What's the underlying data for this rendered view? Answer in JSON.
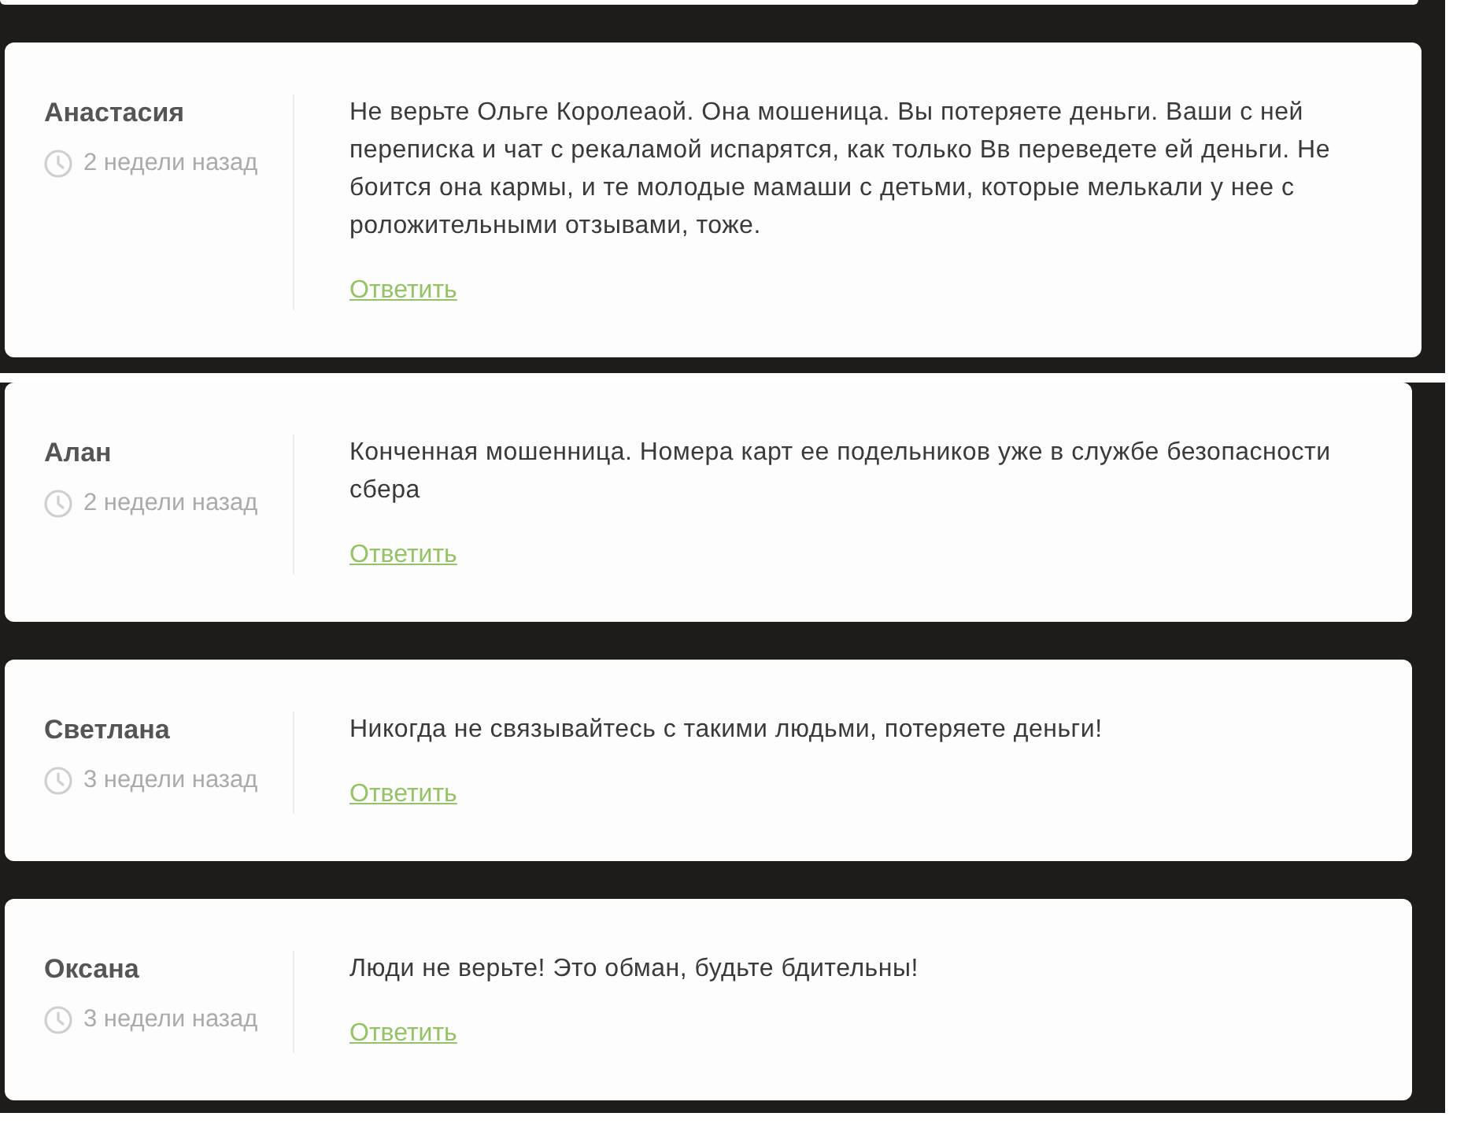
{
  "sections": [
    {
      "partial_card_above": true,
      "comments": [
        {
          "author": "Анастасия",
          "time": "2 недели назад",
          "text": "Не верьте Ольге Королеаой. Она мошеница. Вы потеряете деньги. Ваши с ней переписка и чат с рекаламой испарятся, как только Вв переведете ей деньги. Не боится она кармы, и те молодые мамаши с детьми, которые мелькали у нее с роложительными отзывами, тоже.",
          "reply": "Ответить"
        }
      ]
    },
    {
      "partial_card_above": false,
      "comments": [
        {
          "author": "Алан",
          "time": "2 недели назад",
          "text": "Конченная мошенница. Номера карт ее подельников уже в службе безопасности сбера",
          "reply": "Ответить"
        },
        {
          "author": "Светлана",
          "time": "3 недели назад",
          "text": "Никогда не связывайтесь с такими людьми, потеряете деньги!",
          "reply": "Ответить"
        },
        {
          "author": "Оксана",
          "time": "3 недели назад",
          "text": "Люди не верьте! Это обман, будьте бдительны!",
          "reply": "Ответить"
        }
      ]
    }
  ]
}
